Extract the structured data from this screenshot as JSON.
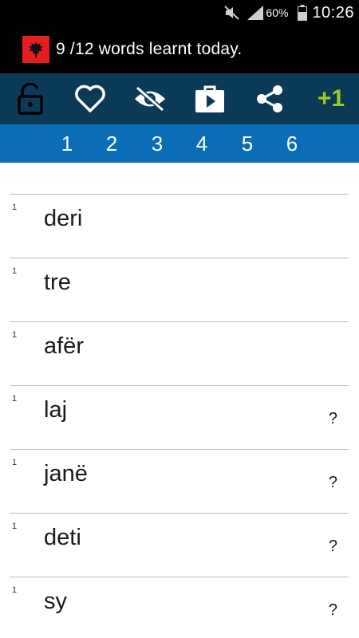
{
  "status_bar": {
    "icons": [
      "mute-icon",
      "signal-icon",
      "battery-icon"
    ],
    "battery": "60%",
    "time": "10:26"
  },
  "header": {
    "flag_icon": "albanian-flag-icon",
    "progress_text": "9 /12 words learnt today."
  },
  "toolbar": {
    "icons": [
      "unlock-icon",
      "heart-icon",
      "eye-off-icon",
      "play-store-icon",
      "share-icon"
    ],
    "plus_label": "+1",
    "colors": {
      "background": "#0b3a57",
      "plus": "#9acd1b"
    }
  },
  "tabs": [
    {
      "label": "1",
      "selected": true
    },
    {
      "label": "2"
    },
    {
      "label": "3"
    },
    {
      "label": "4"
    },
    {
      "label": "5"
    },
    {
      "label": "6"
    }
  ],
  "words": [
    {
      "level": "1",
      "word": "deri",
      "hint": ""
    },
    {
      "level": "1",
      "word": "tre",
      "hint": ""
    },
    {
      "level": "1",
      "word": "afër",
      "hint": ""
    },
    {
      "level": "1",
      "word": "laj",
      "hint": "?"
    },
    {
      "level": "1",
      "word": "janë",
      "hint": "?"
    },
    {
      "level": "1",
      "word": "deti",
      "hint": "?"
    },
    {
      "level": "1",
      "word": "sy",
      "hint": "?"
    }
  ]
}
